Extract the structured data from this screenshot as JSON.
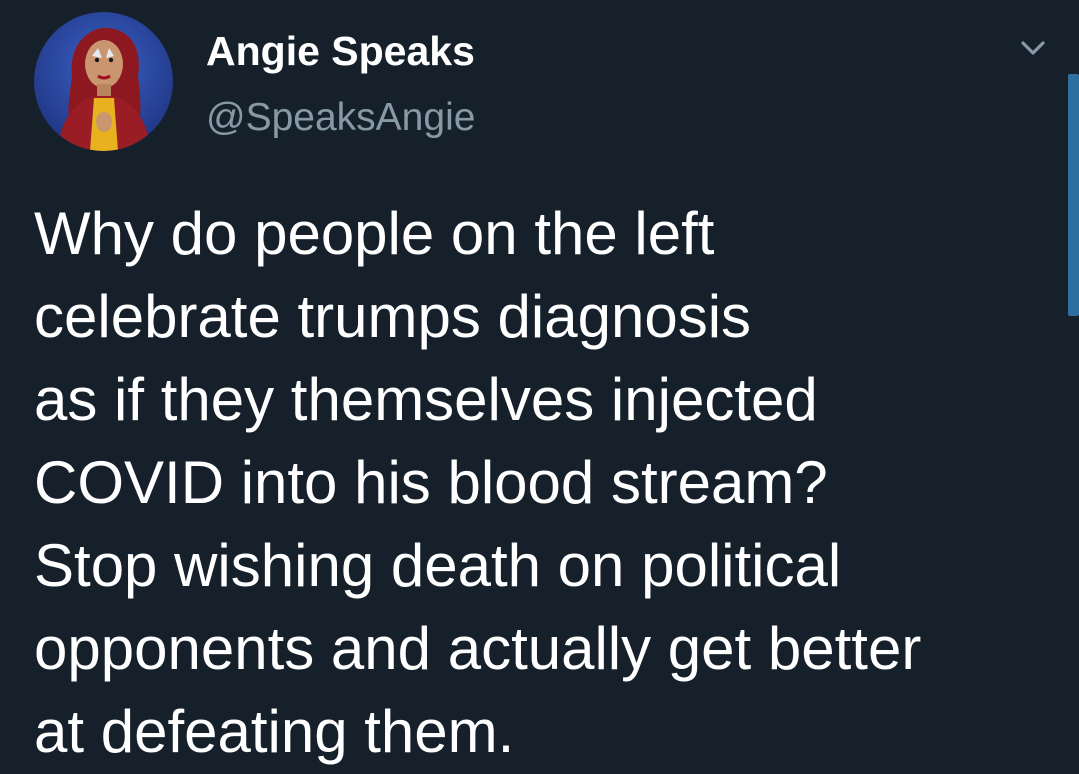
{
  "author": {
    "display_name": "Angie Speaks",
    "handle": "@SpeaksAngie",
    "avatar_icon": "profile-photo"
  },
  "tweet": {
    "lines": [
      "Why do people on the left",
      "celebrate trumps diagnosis",
      "as if they themselves injected",
      "COVID into his blood stream?",
      "Stop wishing death on political",
      "opponents and actually get better",
      "at defeating them."
    ]
  },
  "menu": {
    "icon": "chevron-down-icon"
  },
  "colors": {
    "background": "#15202b",
    "text": "#ffffff",
    "secondary_text": "#8899a6",
    "scrollbar": "#2f6f9f"
  }
}
